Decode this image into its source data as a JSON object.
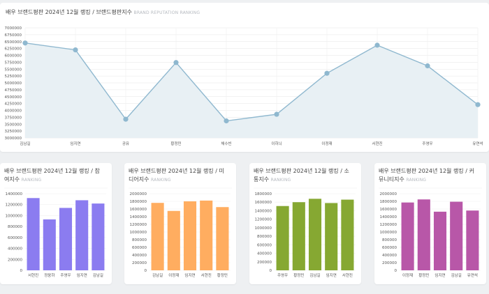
{
  "main": {
    "title": "배우 브랜드평판 2024년 12월 랭킹 / 브랜드평판지수",
    "subtitle": "BRAND REPUTATION RANKING"
  },
  "small_charts": [
    {
      "title_line1": "배우 브랜드평판 2024년 12월 랭킹 / 참",
      "title_line2": "여지수",
      "subtitle": "RANKING"
    },
    {
      "title_line1": "배우 브랜드평판 2024년 12월 랭킹 / 미",
      "title_line2": "디어지수",
      "subtitle": "RANKING"
    },
    {
      "title_line1": "배우 브랜드평판 2024년 12월 랭킹 / 소",
      "title_line2": "통지수",
      "subtitle": "RANKING"
    },
    {
      "title_line1": "배우 브랜드평판 2024년 12월 랭킹 / 커",
      "title_line2": "뮤니티지수",
      "subtitle": "RANKING"
    }
  ],
  "chart_data": [
    {
      "type": "area",
      "title": "배우 브랜드평판 2024년 12월 랭킹 / 브랜드평판지수",
      "categories": [
        "김남길",
        "임지연",
        "공유",
        "황정민",
        "채수빈",
        "이하늬",
        "이정재",
        "서현진",
        "주영우",
        "유연석"
      ],
      "values": [
        6450000,
        6200000,
        3680000,
        5740000,
        3620000,
        3860000,
        5350000,
        6370000,
        5620000,
        4210000
      ],
      "ylim": [
        3000000,
        7000000
      ],
      "yticks": [
        3000000,
        3250000,
        3500000,
        3750000,
        4000000,
        4250000,
        4500000,
        4750000,
        5000000,
        5250000,
        5500000,
        5750000,
        6000000,
        6250000,
        6500000,
        6750000,
        7000000
      ],
      "color": "#8fb8cf",
      "fill": "#e8f0f4",
      "grid": true
    },
    {
      "type": "bar",
      "title": "배우 브랜드평판 2024년 12월 랭킹 / 참여지수",
      "categories": [
        "서현진",
        "정웅하",
        "주영우",
        "임지연",
        "김남길"
      ],
      "values": [
        1320000,
        930000,
        1140000,
        1280000,
        1220000
      ],
      "ylim": [
        0,
        1400000
      ],
      "yticks": [
        0,
        200000,
        400000,
        600000,
        800000,
        1000000,
        1200000,
        1400000
      ],
      "color": "#8b7cf0"
    },
    {
      "type": "bar",
      "title": "배우 브랜드평판 2024년 12월 랭킹 / 미디어지수",
      "categories": [
        "김남길",
        "이정재",
        "임지연",
        "서현진",
        "황정민"
      ],
      "values": [
        1760000,
        1550000,
        1800000,
        1820000,
        1650000
      ],
      "ylim": [
        0,
        2000000
      ],
      "yticks": [
        0,
        200000,
        400000,
        600000,
        800000,
        1000000,
        1200000,
        1400000,
        1600000,
        1800000,
        2000000
      ],
      "color": "#ffad60"
    },
    {
      "type": "bar",
      "title": "배우 브랜드평판 2024년 12월 랭킹 / 소통지수",
      "categories": [
        "주영우",
        "황정민",
        "김남길",
        "임지연",
        "서현진"
      ],
      "values": [
        1510000,
        1600000,
        1680000,
        1580000,
        1660000
      ],
      "ylim": [
        0,
        1800000
      ],
      "yticks": [
        0,
        200000,
        400000,
        600000,
        800000,
        1000000,
        1200000,
        1400000,
        1600000,
        1800000
      ],
      "color": "#86a832"
    },
    {
      "type": "bar",
      "title": "배우 브랜드평판 2024년 12월 랭킹 / 커뮤니티지수",
      "categories": [
        "이정재",
        "황정민",
        "임지연",
        "김남길",
        "유연석"
      ],
      "values": [
        1770000,
        1850000,
        1530000,
        1790000,
        1560000
      ],
      "ylim": [
        0,
        2000000
      ],
      "yticks": [
        0,
        200000,
        400000,
        600000,
        800000,
        1000000,
        1200000,
        1400000,
        1600000,
        1800000,
        2000000
      ],
      "color": "#b857a8"
    }
  ]
}
